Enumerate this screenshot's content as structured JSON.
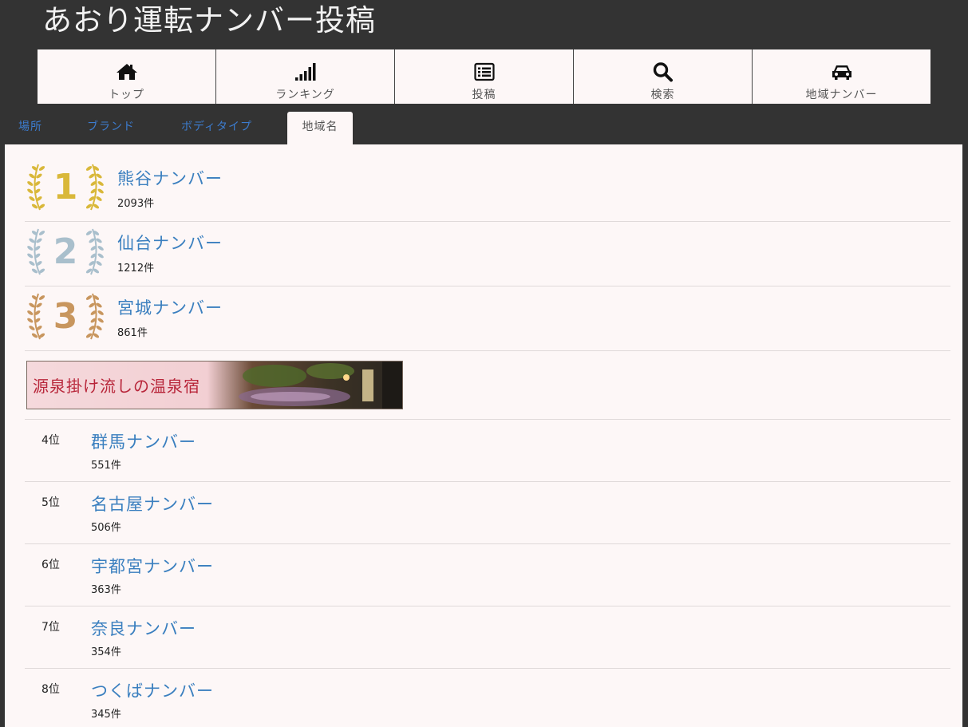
{
  "site": {
    "title": "あおり運転ナンバー投稿"
  },
  "nav": [
    {
      "label": "トップ",
      "icon": "home-icon"
    },
    {
      "label": "ランキング",
      "icon": "signal-bars-icon"
    },
    {
      "label": "投稿",
      "icon": "list-icon"
    },
    {
      "label": "検索",
      "icon": "search-icon"
    },
    {
      "label": "地域ナンバー",
      "icon": "car-icon"
    }
  ],
  "tabs": [
    {
      "label": "場所",
      "active": false
    },
    {
      "label": "ブランド",
      "active": false
    },
    {
      "label": "ボディタイプ",
      "active": false
    },
    {
      "label": "地域名",
      "active": true
    }
  ],
  "top3": [
    {
      "rank": "1",
      "name": "熊谷ナンバー",
      "count": "2093件",
      "color": "#d9b83a"
    },
    {
      "rank": "2",
      "name": "仙台ナンバー",
      "count": "1212件",
      "color": "#a9bfcc"
    },
    {
      "rank": "3",
      "name": "宮城ナンバー",
      "count": "861件",
      "color": "#c8965e"
    }
  ],
  "ad": {
    "text": "源泉掛け流しの温泉宿"
  },
  "rankings": [
    {
      "rank": "4位",
      "name": "群馬ナンバー",
      "count": "551件"
    },
    {
      "rank": "5位",
      "name": "名古屋ナンバー",
      "count": "506件"
    },
    {
      "rank": "6位",
      "name": "宇都宮ナンバー",
      "count": "363件"
    },
    {
      "rank": "7位",
      "name": "奈良ナンバー",
      "count": "354件"
    },
    {
      "rank": "8位",
      "name": "つくばナンバー",
      "count": "345件"
    }
  ]
}
